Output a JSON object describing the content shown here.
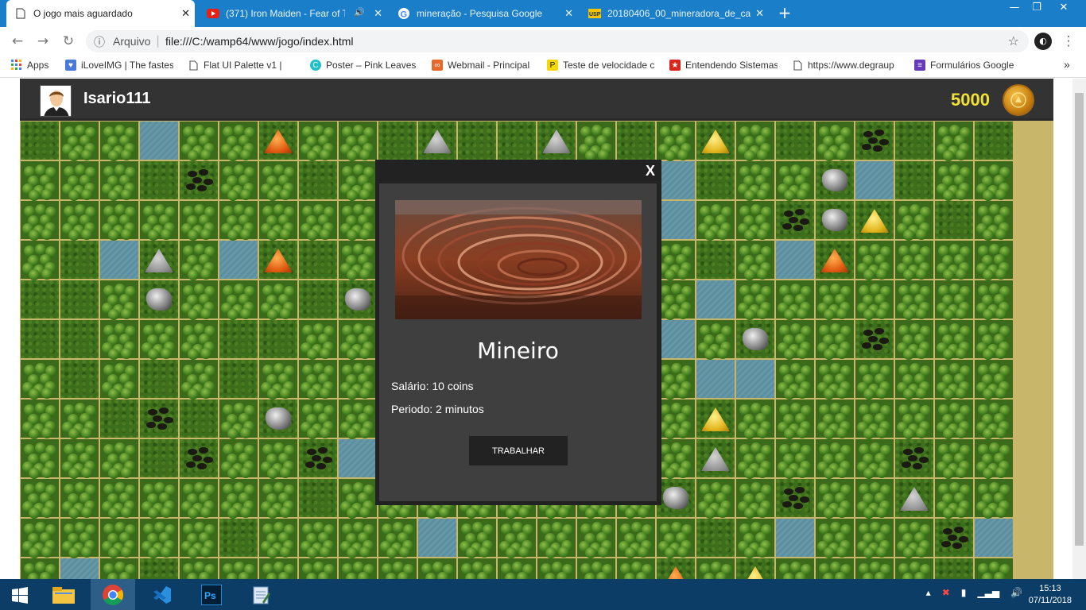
{
  "browser": {
    "tabs": [
      {
        "title": "O jogo mais aguardado",
        "active": true,
        "icon": "page-icon"
      },
      {
        "title": "(371) Iron Maiden - Fear of T",
        "active": false,
        "icon": "youtube-icon"
      },
      {
        "title": "mineração - Pesquisa Google",
        "active": false,
        "icon": "google-icon"
      },
      {
        "title": "20180406_00_mineradora_de_ca",
        "active": false,
        "icon": "usp-icon"
      }
    ],
    "address": {
      "scheme_label": "Arquivo",
      "url": "file:///C:/wamp64/www/jogo/index.html"
    },
    "bookmarks": [
      {
        "label": "Apps"
      },
      {
        "label": "iLoveIMG | The fastes"
      },
      {
        "label": "Flat UI Palette v1 |"
      },
      {
        "label": "Poster – Pink Leaves"
      },
      {
        "label": "Webmail - Principal"
      },
      {
        "label": "Teste de velocidade c"
      },
      {
        "label": "Entendendo Sistemas"
      },
      {
        "label": "https://www.degraup"
      },
      {
        "label": "Formulários Google"
      }
    ],
    "more_bookmarks": "»"
  },
  "game": {
    "player": {
      "username": "Isario111"
    },
    "coins": "5000",
    "modal": {
      "close_label": "X",
      "job_title": "Mineiro",
      "salary": "Salário: 10 coins",
      "period": "Periodo: 2 minutos",
      "button_label": "TRABALHAR"
    }
  },
  "taskbar": {
    "time": "15:13",
    "date": "07/11/2018"
  }
}
